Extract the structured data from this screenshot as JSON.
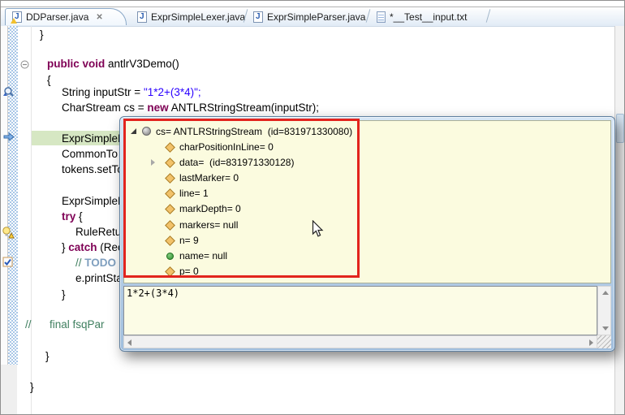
{
  "tab_bar": {
    "close_glyph": "✕"
  },
  "tabs": [
    {
      "label": "DDParser.java",
      "icon": "java-file-warning-icon",
      "icon_letter": "J",
      "active": true
    },
    {
      "label": "ExprSimpleLexer.java",
      "icon": "java-file-icon",
      "icon_letter": "J",
      "active": false
    },
    {
      "label": "ExprSimpleParser.java",
      "icon": "java-file-icon",
      "icon_letter": "J",
      "active": false
    },
    {
      "label": "*__Test__input.txt",
      "icon": "text-file-icon",
      "icon_letter": "",
      "active": false
    }
  ],
  "editor": {
    "code_lines": [
      [
        {
          "text": "}",
          "kind": "plain"
        }
      ],
      [
        {
          "text": "public void",
          "kind": "keyword"
        },
        {
          "text": " antlrV3Demo()",
          "kind": "plain"
        }
      ],
      [
        {
          "text": "{",
          "kind": "plain"
        }
      ],
      [
        {
          "text": "String inputStr = ",
          "kind": "plain"
        },
        {
          "text": "\"1*2+(3*4)\";",
          "kind": "string"
        }
      ],
      [
        {
          "text": "CharStream cs = ",
          "kind": "plain"
        },
        {
          "text": "new",
          "kind": "keyword"
        },
        {
          "text": " ANTLRStringStream(inputStr);",
          "kind": "plain"
        }
      ],
      [
        {
          "text": "ExprSimpleL",
          "kind": "plain"
        }
      ],
      [
        {
          "text": "CommonTo",
          "kind": "plain"
        }
      ],
      [
        {
          "text": "tokens.setTo",
          "kind": "plain"
        }
      ],
      [
        {
          "text": "ExprSimpleP",
          "kind": "plain"
        }
      ],
      [
        {
          "text": "try",
          "kind": "keyword"
        },
        {
          "text": " {",
          "kind": "plain"
        }
      ],
      [
        {
          "text": "RuleRetu",
          "kind": "plain"
        }
      ],
      [
        {
          "text": "} ",
          "kind": "plain"
        },
        {
          "text": "catch",
          "kind": "keyword"
        },
        {
          "text": " (Rec",
          "kind": "plain"
        }
      ],
      [
        {
          "text": "// ",
          "kind": "comment"
        },
        {
          "text": "TODO",
          "kind": "task-tag"
        }
      ],
      [
        {
          "text": "e.printSta",
          "kind": "plain"
        }
      ],
      [
        {
          "text": "}",
          "kind": "plain"
        }
      ],
      [
        {
          "text": "//      final fsqPar",
          "kind": "comment"
        }
      ],
      [
        {
          "text": "}",
          "kind": "plain"
        }
      ],
      [
        {
          "text": "}",
          "kind": "plain"
        }
      ]
    ]
  },
  "debug_popup": {
    "root": {
      "icon": "object-icon",
      "label": "cs= ANTLRStringStream  (id=831971330080)"
    },
    "variables": [
      {
        "icon": "protected-field-icon",
        "label": "charPositionInLine= 0",
        "expandable": false
      },
      {
        "icon": "protected-field-icon",
        "label": "data=  (id=831971330128)",
        "expandable": true
      },
      {
        "icon": "protected-field-icon",
        "label": "lastMarker= 0",
        "expandable": false
      },
      {
        "icon": "protected-field-icon",
        "label": "line= 1",
        "expandable": false
      },
      {
        "icon": "protected-field-icon",
        "label": "markDepth= 0",
        "expandable": false
      },
      {
        "icon": "protected-field-icon",
        "label": "markers= null",
        "expandable": false
      },
      {
        "icon": "protected-field-icon",
        "label": "n= 9",
        "expandable": false
      },
      {
        "icon": "public-field-icon",
        "label": "name= null",
        "expandable": false
      },
      {
        "icon": "protected-field-icon",
        "label": "p= 0",
        "expandable": false
      }
    ],
    "value_preview": "1*2+(3*4)"
  },
  "colors": {
    "keyword": "#7f0055",
    "string": "#2a00ff",
    "comment": "#3f7f5f",
    "task_tag": "#7f9fbf",
    "popup_bg": "#fbfbdf",
    "highlight_line": "#d6e7c3",
    "annotation_box": "#e2241d"
  }
}
